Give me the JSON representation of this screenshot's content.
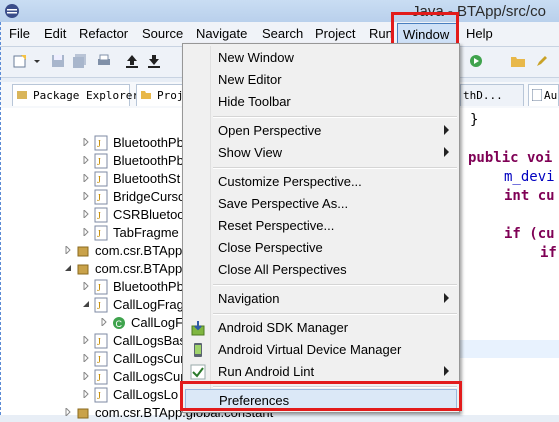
{
  "window": {
    "title": "Java - BTApp/src/co"
  },
  "menubar": {
    "items": [
      "File",
      "Edit",
      "Refactor",
      "Source",
      "Navigate",
      "Search",
      "Project",
      "Run"
    ],
    "active": "Window",
    "after": "Help"
  },
  "tabs": {
    "package_explorer": "Package Explorer",
    "project": "Proj",
    "editor_tab1": "thD...",
    "editor_tab2": "Au"
  },
  "tree": {
    "rows": [
      "BluetoothPb",
      "BluetoothPb",
      "BluetoothSt",
      "BridgeCurso",
      "CSRBluetoo",
      "TabFragme",
      "com.csr.BTApp",
      "com.csr.BTApp",
      "BluetoothPb",
      "CallLogFrag",
      "CallLogF",
      "CallLogsBas",
      "CallLogsCur",
      "CallLogsCur",
      "CallLogsLo",
      "com.csr.BTApp.global.constant"
    ]
  },
  "editor": {
    "lines": [
      "}",
      "public voi",
      "m_devi",
      "int cu",
      "if (cu",
      "if"
    ]
  },
  "dropdown": {
    "new_window": "New Window",
    "new_editor": "New Editor",
    "hide_toolbar": "Hide Toolbar",
    "open_perspective": "Open Perspective",
    "show_view": "Show View",
    "customize_perspective": "Customize Perspective...",
    "save_perspective_as": "Save Perspective As...",
    "reset_perspective": "Reset Perspective...",
    "close_perspective": "Close Perspective",
    "close_all_perspectives": "Close All Perspectives",
    "navigation": "Navigation",
    "android_sdk_manager": "Android SDK Manager",
    "android_avd_manager": "Android Virtual Device Manager",
    "run_android_lint": "Run Android Lint",
    "preferences": "Preferences"
  },
  "colors": {
    "highlight_box": "#e21b1b",
    "selection": "#dbe8f7"
  }
}
